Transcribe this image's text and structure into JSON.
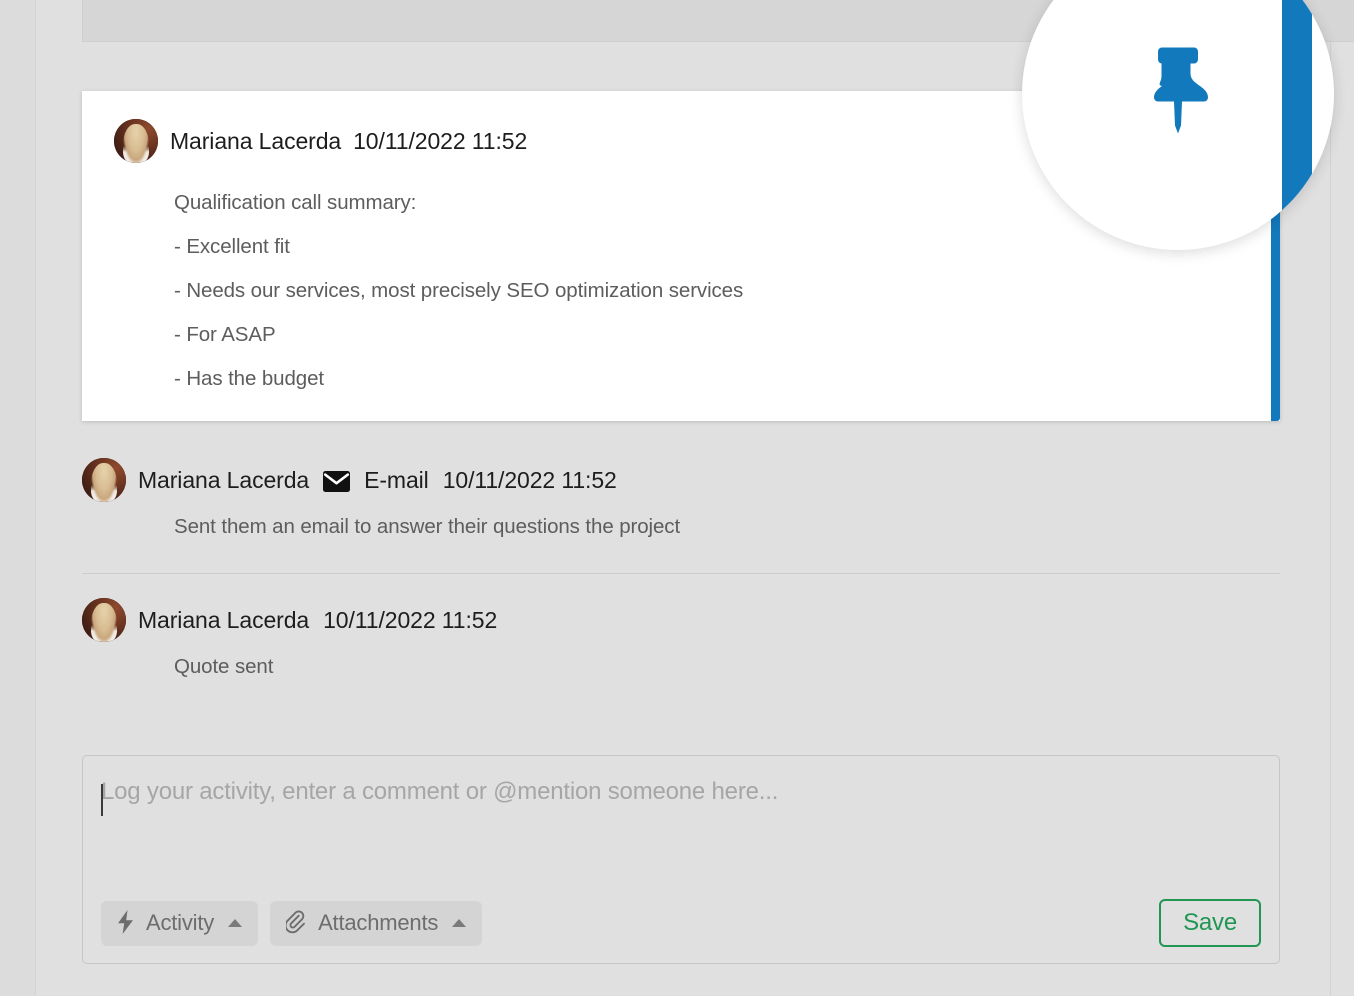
{
  "colors": {
    "background": "#e0e0e0",
    "card_background": "#ffffff",
    "pin_accent": "#1379bd",
    "save_border": "#219653",
    "save_text": "#219653",
    "placeholder_text": "#a6a6a6",
    "body_text": "#5d5d5d",
    "name_text": "#1d1d1d",
    "chip_background": "#d4d4d4",
    "divider": "#cccccc"
  },
  "feed": {
    "pinned_note": {
      "author": "Mariana Lacerda",
      "timestamp": "10/11/2022 11:52",
      "avatar_name": "mariana-lacerda-avatar",
      "pin_icon": "pin-icon",
      "lines": [
        "Qualification call summary:",
        "- Excellent fit",
        "- Needs our services, most precisely SEO optimization services",
        "- For ASAP",
        "- Has the budget"
      ]
    },
    "entries": [
      {
        "author": "Mariana Lacerda",
        "type_icon": "email-icon",
        "type_label": "E-mail",
        "timestamp": "10/11/2022 11:52",
        "body": "Sent them an email to answer their questions the project"
      },
      {
        "author": "Mariana Lacerda",
        "type_icon": null,
        "type_label": null,
        "timestamp": "10/11/2022 11:52",
        "body": "Quote sent"
      }
    ]
  },
  "composer": {
    "placeholder": "Log your activity, enter a comment or @mention someone here...",
    "value": "",
    "activity_button": {
      "label": "Activity",
      "icon": "lightning-bolt-icon",
      "chevron": "chevron-up-icon"
    },
    "attachments_button": {
      "label": "Attachments",
      "icon": "paperclip-icon",
      "chevron": "chevron-up-icon"
    },
    "save_button": {
      "label": "Save"
    }
  }
}
